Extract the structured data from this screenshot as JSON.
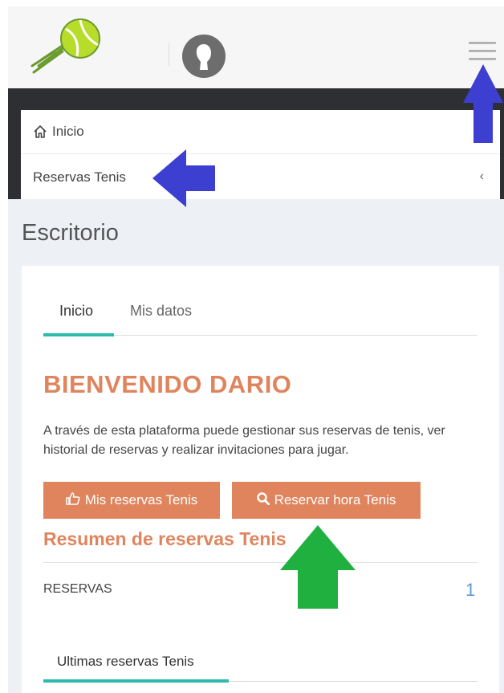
{
  "header": {
    "logo_icon": "tennis-ball-logo-icon",
    "avatar_icon": "user-avatar-icon",
    "menu_icon": "hamburger-menu-icon"
  },
  "breadcrumb": {
    "home_label": "Inicio",
    "section_label": "Reservas Tenis",
    "chevron": "‹"
  },
  "page": {
    "title": "Escritorio"
  },
  "tabs": [
    {
      "label": "Inicio",
      "active": true
    },
    {
      "label": "Mis datos",
      "active": false
    }
  ],
  "welcome": {
    "title": "BIENVENIDO DARIO",
    "description": "A través de esta plataforma puede gestionar sus reservas de tenis, ver historial de reservas y realizar invitaciones para jugar."
  },
  "buttons": {
    "mis_reservas": "Mis reservas Tenis",
    "reservar_hora": "Reservar hora Tenis"
  },
  "summary": {
    "title": "Resumen de reservas Tenis",
    "reservas_label": "RESERVAS",
    "reservas_count": "1"
  },
  "bottom_tabs": [
    {
      "label": "Ultimas reservas Tenis",
      "active": true
    }
  ],
  "colors": {
    "accent": "#e0845d",
    "teal": "#2bbbad",
    "arrow_blue": "#3d3fd1",
    "arrow_green": "#20b040"
  }
}
